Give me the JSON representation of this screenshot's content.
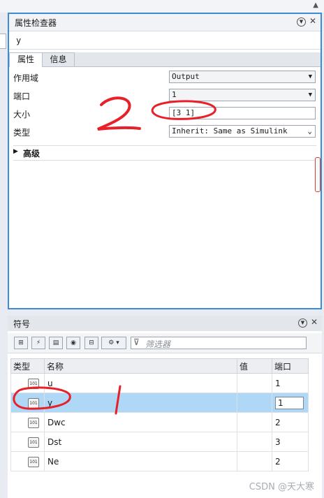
{
  "property_inspector": {
    "title": "属性检查器",
    "name": "y",
    "tabs": [
      "属性",
      "信息"
    ],
    "rows": [
      {
        "label": "作用域",
        "value": "Output"
      },
      {
        "label": "端口",
        "value": "1"
      },
      {
        "label": "大小",
        "value": "[3 1]"
      },
      {
        "label": "类型",
        "value": "Inherit: Same as Simulink"
      }
    ],
    "advanced_label": "高级"
  },
  "symbols": {
    "title": "符号",
    "filter_placeholder": "筛选器",
    "columns": [
      "类型",
      "名称",
      "值",
      "端口"
    ],
    "rows": [
      {
        "name": "u",
        "value": "",
        "port": "1"
      },
      {
        "name": "y",
        "value": "",
        "port": "1"
      },
      {
        "name": "Dwc",
        "value": "",
        "port": "2"
      },
      {
        "name": "Dst",
        "value": "",
        "port": "3"
      },
      {
        "name": "Ne",
        "value": "",
        "port": "2"
      }
    ]
  },
  "annotations": {
    "mark_2": "2",
    "mark_1": "1"
  },
  "watermark": "CSDN @天大寒",
  "colors": {
    "accent_border": "#3d8ad6",
    "selected_row": "#aed8f5",
    "annotation": "#e8202a"
  }
}
